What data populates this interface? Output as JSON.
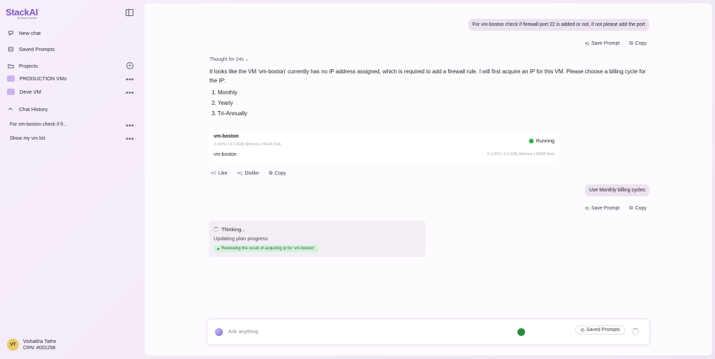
{
  "brand": {
    "name": "StackAI",
    "sub": "By Stack Console"
  },
  "sidebar": {
    "new_chat": "New chat",
    "saved_prompts": "Saved Prompts",
    "projects": "Projects",
    "projects_list": [
      "PRODUCTION VMs",
      "Deve VM"
    ],
    "chat_history_label": "Chat History",
    "history": [
      "For vm-boston check if fi...",
      "Show my vm list"
    ],
    "more": "•••"
  },
  "user": {
    "initials": "VT",
    "name": "Vishakha Tathe",
    "crn": "CRN: #001258"
  },
  "conversation": {
    "msg1": "For vm-boston check if firewall port 22 is added or not, if not please add the port",
    "save_prompt": "Save Prompt",
    "copy": "Copy",
    "thought": "Thought for 24s",
    "ai_text": "It looks like the VM 'vm-boston' currently has no IP address assigned, which is required to add a firewall rule. I will first acquire an IP for this VM. Please choose a billing cycle for the IP:",
    "options": [
      "1. Monthly",
      "2. Yearly",
      "3. Tri-Annually"
    ],
    "vm": {
      "name": "vm-boston",
      "spec": "2 vCPU | 4.0 (GB) Memory | 60GB Disk",
      "status": "Running",
      "name2": "vm-boston",
      "spec2": "2 vCPU | 4.0 (GB) Memory | 60GB Disk"
    },
    "like": "Like",
    "dislike": "Dislike",
    "msg2": "Use Monthly billing cycles",
    "thinking": "Thinking...",
    "thinking_sub": "Updating plan progress",
    "thinking_tag": "Reviewing the result of acquiring ip for 'vm-boston'"
  },
  "input": {
    "placeholder": "Ask anything",
    "saved_prompts": "Saved Prompts"
  },
  "colors": {
    "accent": "#7b55c7",
    "running": "#2aa84a",
    "bubble": "#ece1ef"
  }
}
